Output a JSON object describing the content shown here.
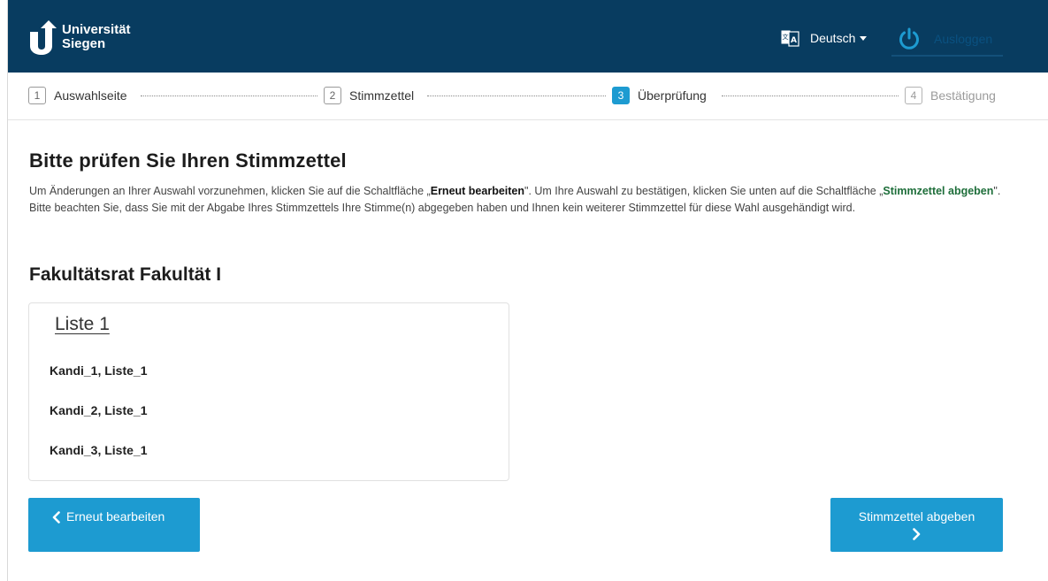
{
  "header": {
    "logo_line1": "Universität",
    "logo_line2": "Siegen",
    "language": "Deutsch",
    "logout_label": "Ausloggen"
  },
  "stepper": {
    "steps": [
      {
        "num": "1",
        "label": "Auswahlseite",
        "state": "done"
      },
      {
        "num": "2",
        "label": "Stimmzettel",
        "state": "done"
      },
      {
        "num": "3",
        "label": "Überprüfung",
        "state": "active"
      },
      {
        "num": "4",
        "label": "Bestätigung",
        "state": "disabled"
      }
    ]
  },
  "main": {
    "title": "Bitte prüfen Sie Ihren Stimmzettel",
    "intro_part1": "Um Änderungen an Ihrer Auswahl vorzunehmen, klicken Sie auf die Schaltfläche „",
    "intro_key1": "Erneut bearbeiten",
    "intro_part2": "\". Um Ihre Auswahl zu bestätigen, klicken Sie unten auf die Schaltfläche „",
    "intro_key2": "Stimmzettel abgeben",
    "intro_part3": "\". Bitte beachten Sie, dass Sie mit der Abgabe Ihres Stimmzettels Ihre Stimme(n) abgegeben haben und Ihnen kein weiterer Stimmzettel für diese Wahl ausgehändigt wird.",
    "election_title": "Fakultätsrat Fakultät I",
    "list_title": "Liste 1",
    "candidates": [
      "Kandi_1, Liste_1",
      "Kandi_2, Liste_1",
      "Kandi_3, Liste_1"
    ]
  },
  "actions": {
    "back_label": "Erneut bearbeiten",
    "submit_label": "Stimmzettel abgeben"
  },
  "colors": {
    "header_bg": "#083c60",
    "accent": "#1d9bd1",
    "logout_text": "#0a5180"
  }
}
